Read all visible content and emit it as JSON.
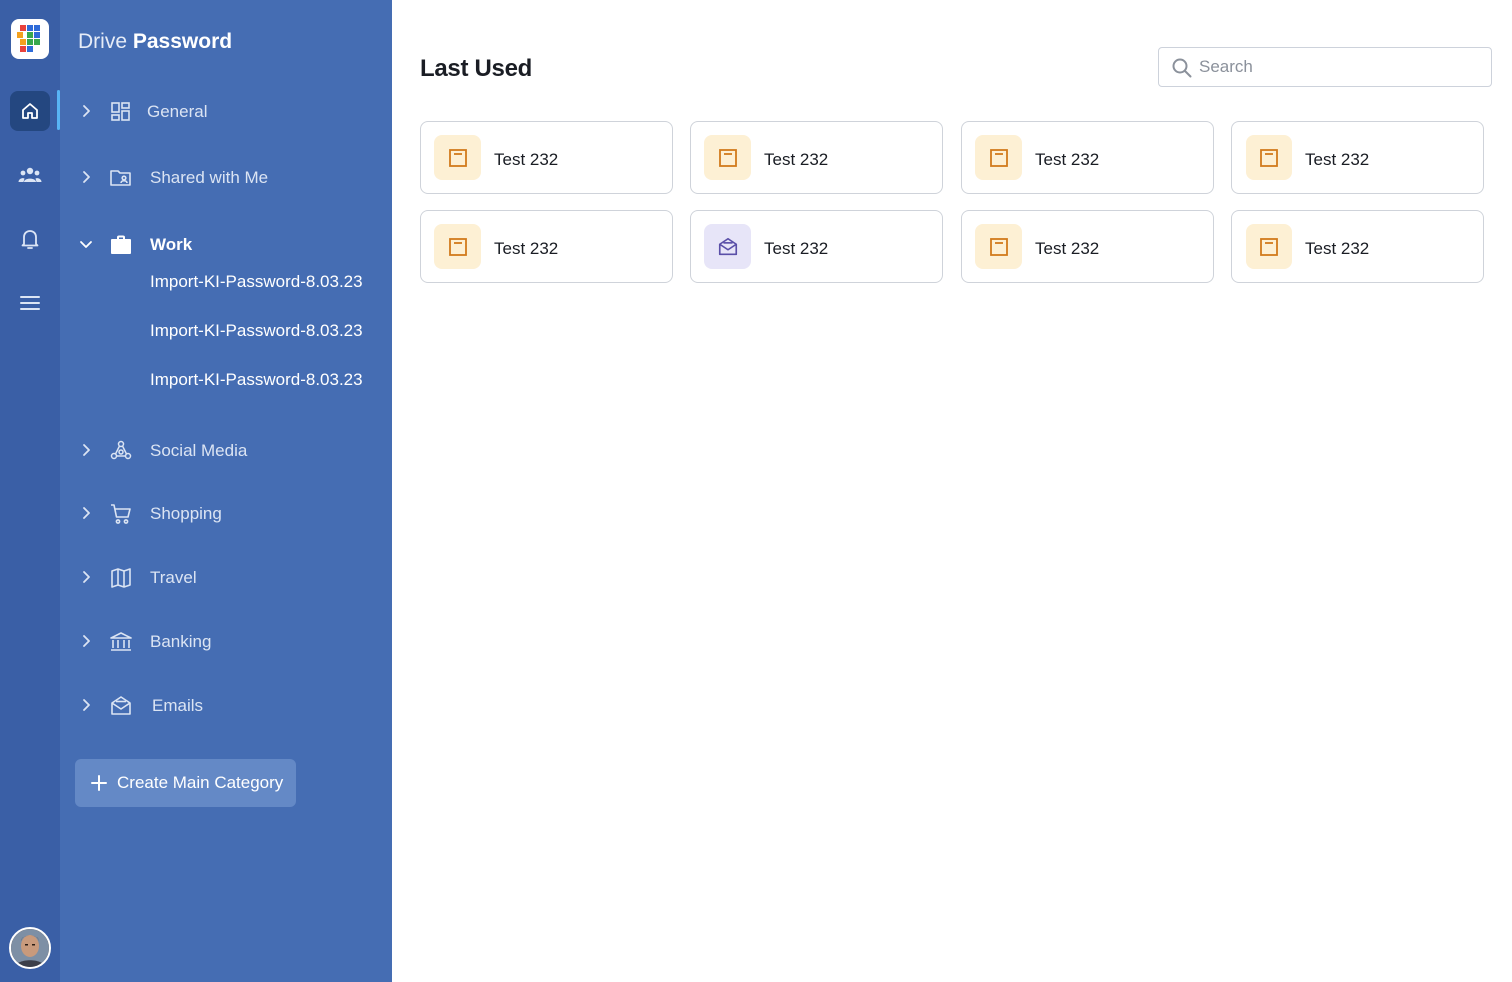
{
  "app": {
    "title_light": "Drive",
    "title_bold": "Password"
  },
  "rail": {
    "items": [
      {
        "icon": "home-icon",
        "active": true
      },
      {
        "icon": "users-icon",
        "active": false
      },
      {
        "icon": "bell-icon",
        "active": false
      },
      {
        "icon": "menu-icon",
        "active": false
      }
    ]
  },
  "sidebar": {
    "categories": [
      {
        "label": "General",
        "icon": "dashboard-grid-icon",
        "expanded": false
      },
      {
        "label": "Shared with Me",
        "icon": "shared-folder-icon",
        "expanded": false
      },
      {
        "label": "Work",
        "icon": "briefcase-icon",
        "expanded": true,
        "children": [
          "Import-KI-Password-8.03.23",
          "Import-KI-Password-8.03.23",
          "Import-KI-Password-8.03.23"
        ]
      },
      {
        "label": "Social Media",
        "icon": "network-icon",
        "expanded": false
      },
      {
        "label": "Shopping",
        "icon": "cart-icon",
        "expanded": false
      },
      {
        "label": "Travel",
        "icon": "map-icon",
        "expanded": false
      },
      {
        "label": "Banking",
        "icon": "bank-icon",
        "expanded": false
      },
      {
        "label": "Emails",
        "icon": "envelope-open-icon",
        "expanded": false
      }
    ],
    "create_label": "Create Main Category"
  },
  "main": {
    "title": "Last Used",
    "search": {
      "placeholder": "Search",
      "value": ""
    },
    "cards": [
      {
        "label": "Test 232",
        "icon": "window-icon",
        "variant": "orange"
      },
      {
        "label": "Test 232",
        "icon": "window-icon",
        "variant": "orange"
      },
      {
        "label": "Test 232",
        "icon": "window-icon",
        "variant": "orange"
      },
      {
        "label": "Test 232",
        "icon": "window-icon",
        "variant": "orange"
      },
      {
        "label": "Test 232",
        "icon": "window-icon",
        "variant": "orange"
      },
      {
        "label": "Test 232",
        "icon": "envelope-open-icon",
        "variant": "purple"
      },
      {
        "label": "Test 232",
        "icon": "window-icon",
        "variant": "orange"
      },
      {
        "label": "Test 232",
        "icon": "window-icon",
        "variant": "orange"
      }
    ]
  },
  "colors": {
    "rail": "#3a5fa6",
    "sidebar": "#456db3",
    "accent": "#58b4f5",
    "orange_icon": "#d17a1c",
    "purple_icon": "#5a4fa8"
  }
}
